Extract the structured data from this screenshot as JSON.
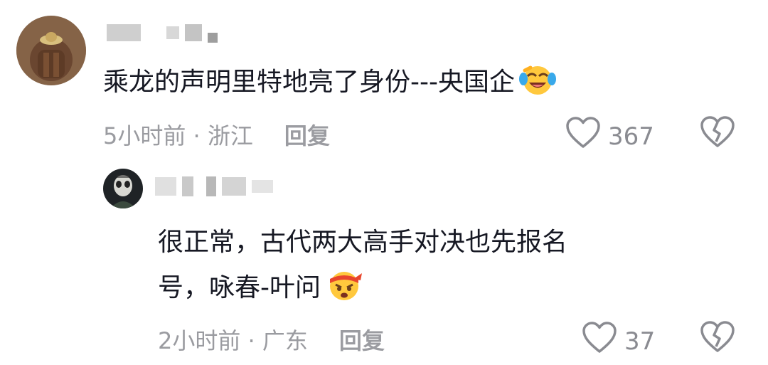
{
  "comments": [
    {
      "text": "乘龙的声明里特地亮了身份---央国企",
      "emoji": "laughing-crying-emoji",
      "time_location": "5小时前 · 浙江",
      "reply_label": "回复",
      "like_count": "367"
    }
  ],
  "replies": [
    {
      "text_line1": "很正常，古代两大高手对决也先报名",
      "text_line2": "号，咏春-叶问",
      "emoji": "headband-emoji",
      "time_location": "2小时前 · 广东",
      "reply_label": "回复",
      "like_count": "37"
    }
  ],
  "icons": {
    "like": "heart-outline-icon",
    "dislike": "broken-heart-icon"
  },
  "colors": {
    "text": "#161823",
    "meta": "#9a9ba0",
    "blur_block": "#c8c8c8"
  }
}
